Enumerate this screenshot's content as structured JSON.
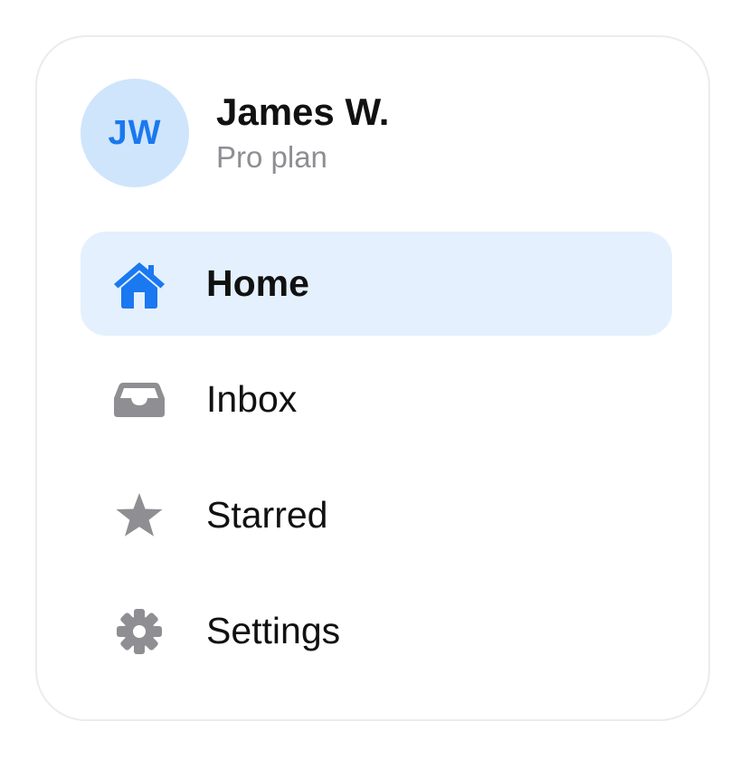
{
  "profile": {
    "initials": "JW",
    "name": "James W.",
    "plan": "Pro plan"
  },
  "nav": {
    "items": [
      {
        "label": "Home",
        "icon": "house-icon",
        "active": true
      },
      {
        "label": "Inbox",
        "icon": "inbox-tray-icon",
        "active": false
      },
      {
        "label": "Starred",
        "icon": "star-icon",
        "active": false
      },
      {
        "label": "Settings",
        "icon": "gear-icon",
        "active": false
      }
    ]
  },
  "colors": {
    "accent": "#1a78f0",
    "active_background": "#e4f0fd",
    "avatar_background": "#cfe5fc",
    "icon_inactive": "#8e8e93",
    "text_primary": "#111111",
    "text_secondary": "#8e8e93"
  }
}
